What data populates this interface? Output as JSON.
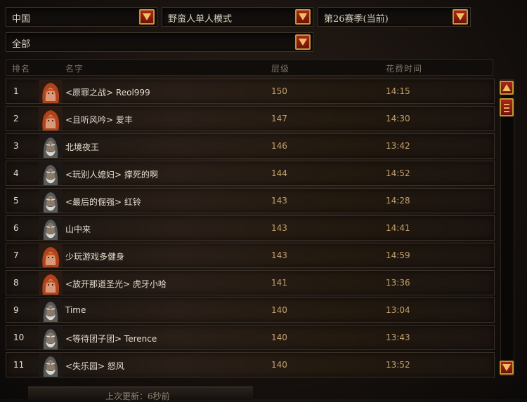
{
  "filters": {
    "region": "中国",
    "mode": "野蛮人单人模式",
    "season": "第26赛季(当前)",
    "category": "全部"
  },
  "columns": {
    "rank": "排名",
    "name": "名字",
    "tier": "层级",
    "time": "花费时间"
  },
  "rows": [
    {
      "rank": "1",
      "portrait": "red-hair",
      "name": "<原罪之战> Reol999",
      "tier": "150",
      "time": "14:15"
    },
    {
      "rank": "2",
      "portrait": "red-hair",
      "name": "<且听风吟> 爱丰",
      "tier": "147",
      "time": "14:30"
    },
    {
      "rank": "3",
      "portrait": "old-man",
      "name": "北境夜王",
      "tier": "146",
      "time": "13:42"
    },
    {
      "rank": "4",
      "portrait": "old-man",
      "name": "<玩别人媳妇> 撑死的啊",
      "tier": "144",
      "time": "14:52"
    },
    {
      "rank": "5",
      "portrait": "old-man",
      "name": "<最后的倔强> 红铃",
      "tier": "143",
      "time": "14:28"
    },
    {
      "rank": "6",
      "portrait": "old-man",
      "name": "山中来",
      "tier": "143",
      "time": "14:41"
    },
    {
      "rank": "7",
      "portrait": "red-hair",
      "name": "少玩游戏多健身",
      "tier": "143",
      "time": "14:59"
    },
    {
      "rank": "8",
      "portrait": "red-hair",
      "name": "<放开那道圣光> 虎牙小哈",
      "tier": "141",
      "time": "13:36"
    },
    {
      "rank": "9",
      "portrait": "old-man",
      "name": "Time",
      "tier": "140",
      "time": "13:04"
    },
    {
      "rank": "10",
      "portrait": "old-man",
      "name": "<等待团子团> Terence",
      "tier": "140",
      "time": "13:43"
    },
    {
      "rank": "11",
      "portrait": "old-man",
      "name": "<失乐园> 怒风",
      "tier": "140",
      "time": "13:52"
    }
  ],
  "footer": {
    "last_update": "上次更新：6秒前"
  },
  "colors": {
    "accent_red": "#8e1a10",
    "gold_border": "#c6952f",
    "tier_text": "#c1a06a"
  }
}
